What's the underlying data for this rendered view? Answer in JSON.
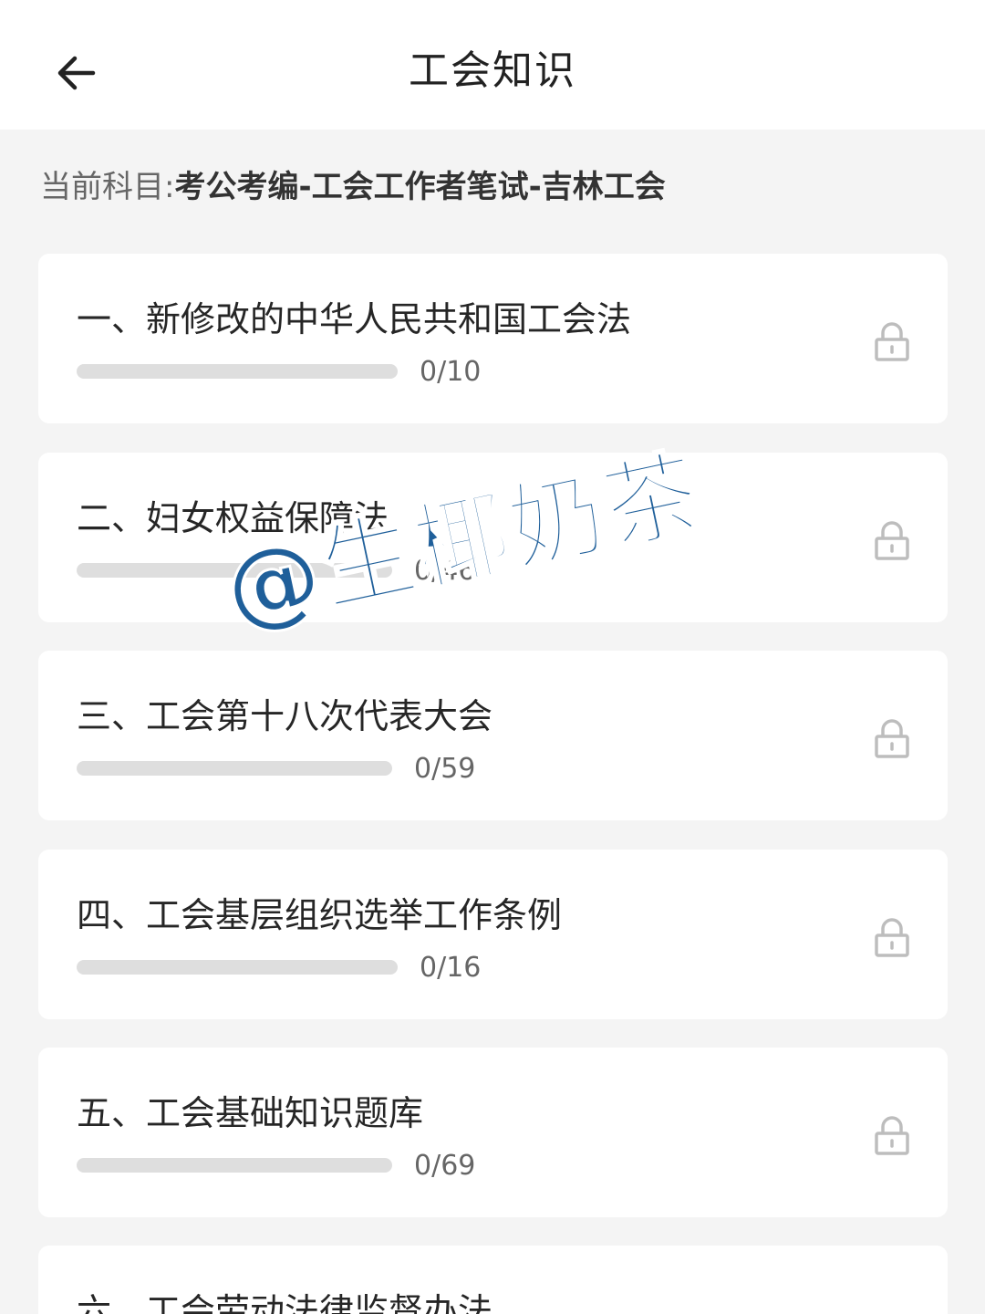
{
  "header": {
    "title": "工会知识",
    "back_icon": "arrow-left-icon"
  },
  "subject": {
    "label": "当前科目:",
    "value": "考公考编-工会工作者笔试-吉林工会"
  },
  "chapters": [
    {
      "title": "一、新修改的中华人民共和国工会法",
      "count": "0/10",
      "done": 0,
      "total": 10,
      "locked": true
    },
    {
      "title": "二、妇女权益保障法",
      "count": "0/46",
      "done": 0,
      "total": 46,
      "locked": true
    },
    {
      "title": "三、工会第十八次代表大会",
      "count": "0/59",
      "done": 0,
      "total": 59,
      "locked": true
    },
    {
      "title": "四、工会基层组织选举工作条例",
      "count": "0/16",
      "done": 0,
      "total": 16,
      "locked": true
    },
    {
      "title": "五、工会基础知识题库",
      "count": "0/69",
      "done": 0,
      "total": 69,
      "locked": true
    },
    {
      "title": "六、工会劳动法律监督办法"
    }
  ],
  "watermark": "@生椰奶茶",
  "colors": {
    "background": "#f4f4f4",
    "card": "#ffffff",
    "progress_track": "#dedede",
    "lock_icon": "#bdbdbd",
    "watermark": "#1f5f9a"
  }
}
